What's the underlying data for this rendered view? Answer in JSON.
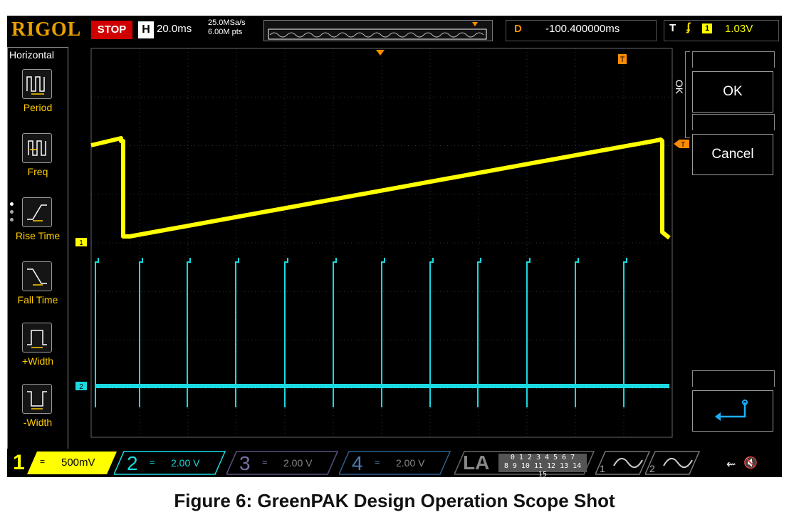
{
  "brand": "RIGOL",
  "run_state": "STOP",
  "horizontal": {
    "label": "H",
    "timebase": "20.0ms",
    "sample_rate": "25.0MSa/s",
    "mem_depth": "6.00M pts"
  },
  "delay": {
    "label": "D",
    "value": "-100.400000ms"
  },
  "trigger": {
    "label": "T",
    "edge_icon": "rising-edge-icon",
    "source": "1",
    "level": "1.03V"
  },
  "left_menu": {
    "title": "Horizontal",
    "items": [
      {
        "label": "Period",
        "icon": "period-icon"
      },
      {
        "label": "Freq",
        "icon": "frequency-icon"
      },
      {
        "label": "Rise Time",
        "icon": "rise-time-icon"
      },
      {
        "label": "Fall Time",
        "icon": "fall-time-icon"
      },
      {
        "label": "+Width",
        "icon": "positive-width-icon"
      },
      {
        "label": "-Width",
        "icon": "negative-width-icon"
      }
    ]
  },
  "right_menu": {
    "side_label": "OK",
    "ok_label": "OK",
    "cancel_label": "Cancel",
    "enter_icon": "return-arrow-icon"
  },
  "markers": {
    "ch1": "1",
    "ch2": "2",
    "trigger_level": "T",
    "trigger_pos": "T"
  },
  "channels": [
    {
      "num": "1",
      "coupling": "=",
      "scale": "500mV",
      "color": "#ffff00",
      "active": true
    },
    {
      "num": "2",
      "coupling": "=",
      "scale": "2.00 V",
      "color": "#1ad9e0",
      "active": true
    },
    {
      "num": "3",
      "coupling": "=",
      "scale": "2.00 V",
      "color": "#7a6fa0",
      "active": false
    },
    {
      "num": "4",
      "coupling": "=",
      "scale": "2.00 V",
      "color": "#4a7fb0",
      "active": false
    }
  ],
  "logic_analyzer": {
    "label": "LA",
    "bits_top": "0 1 2 3   4 5 6 7",
    "bits_bottom": "8 9 10 11  12 13 14 15"
  },
  "math": [
    {
      "label": "1"
    },
    {
      "label": "2"
    }
  ],
  "status_icons": [
    "usb-icon",
    "speaker-mute-icon"
  ],
  "colors": {
    "ch1": "#ffff00",
    "ch2": "#1ad9e0",
    "brand": "#e8a000",
    "stop": "#d00000",
    "trigger": "#ff8c00"
  },
  "caption": "Figure 6: GreenPAK Design Operation Scope Shot"
}
